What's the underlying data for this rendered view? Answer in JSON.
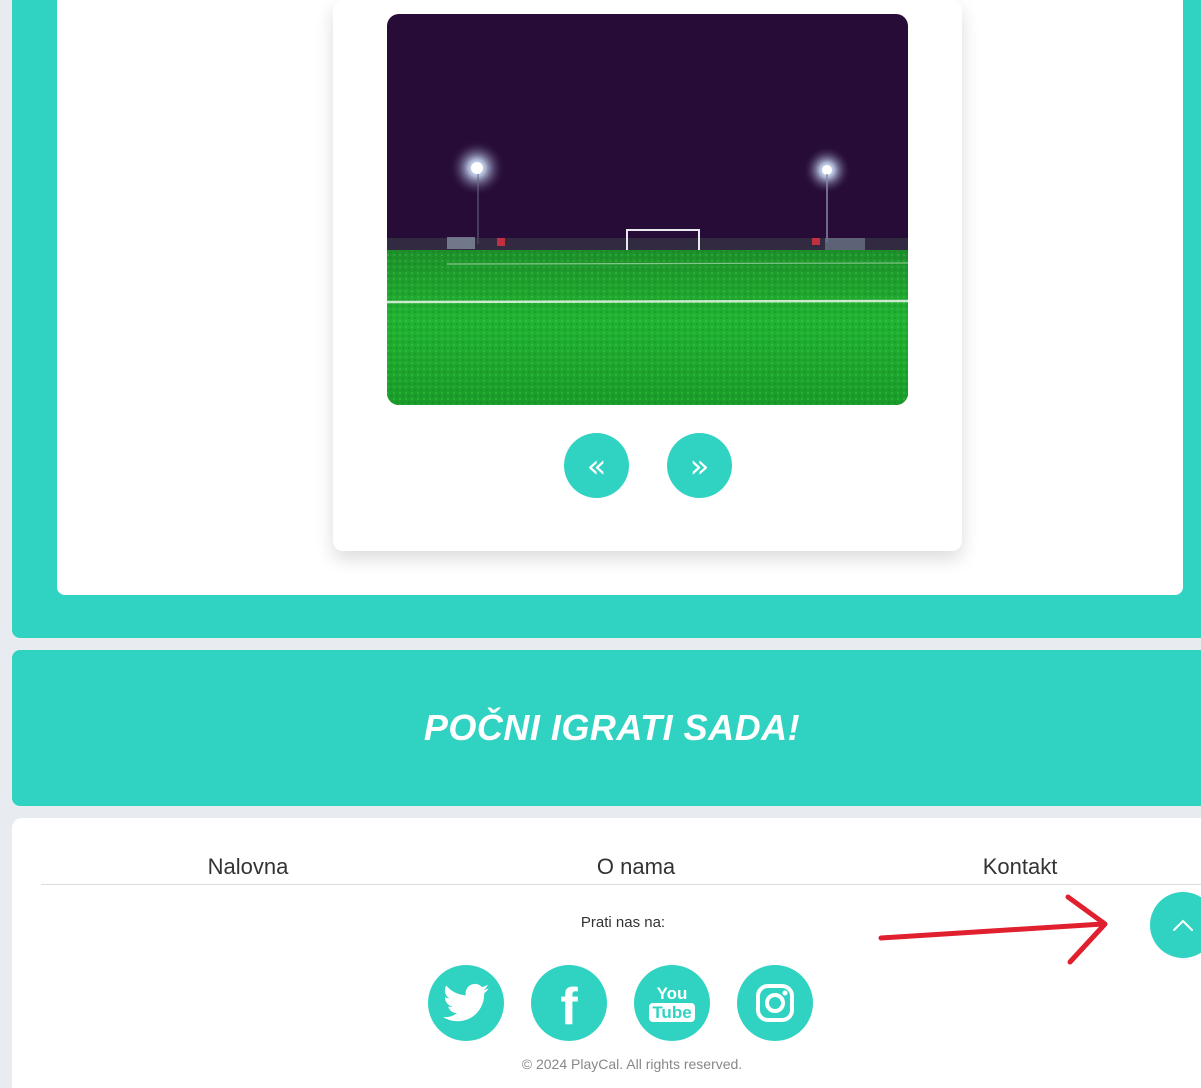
{
  "carousel": {
    "prev_symbol": "«",
    "next_symbol": "»"
  },
  "cta": {
    "title": "POČNI IGRATI SADA!"
  },
  "footer": {
    "nav": [
      "Nalovna",
      "O nama",
      "Kontakt"
    ],
    "follow_label": "Prati nas na:",
    "social": [
      "twitter-icon",
      "facebook-icon",
      "youtube-icon",
      "instagram-icon"
    ],
    "youtube_text_top": "You",
    "youtube_text_bottom": "Tube",
    "facebook_letter": "f",
    "copyright": "© 2024 PlayCal. All rights reserved."
  },
  "colors": {
    "accent": "#30d3c2",
    "background": "#e8ecf0",
    "annotation": "#e0202e"
  }
}
